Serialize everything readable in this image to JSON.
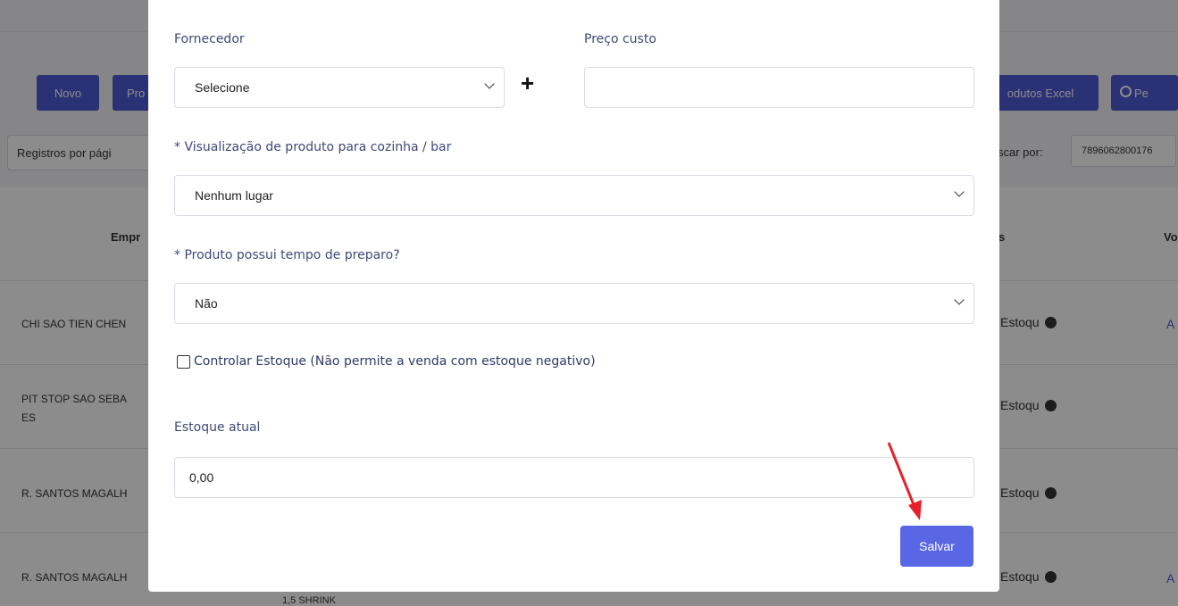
{
  "background": {
    "buttons": {
      "novo": "Novo",
      "pro": "Pro",
      "excel": "odutos Excel",
      "search": "Pe"
    },
    "records_label": "Registros por pági",
    "search_label": "scar por:",
    "search_value": "7896062800176",
    "table": {
      "header_company": "Empr",
      "header_s": "s",
      "header_v": "Vo",
      "rows": [
        {
          "company": "CHI SAO TIEN CHEN",
          "stock": "Estoqu",
          "link": "A"
        },
        {
          "company_line1": "PIT STOP SAO SEBA",
          "company_line2": "ES",
          "stock": "Estoqu"
        },
        {
          "company": "R. SANTOS MAGALH",
          "stock": "Estoqu"
        },
        {
          "company": "R. SANTOS MAGALH",
          "stock": "Estoqu",
          "link": "A",
          "extra": "1,5 SHRINK"
        }
      ]
    }
  },
  "modal": {
    "supplier_label": "Fornecedor",
    "supplier_value": "Selecione",
    "cost_label": "Preço custo",
    "cost_value": "",
    "kitchen_label": "* Visualização de produto para cozinha / bar",
    "kitchen_value": "Nenhum lugar",
    "prep_label": "* Produto possui tempo de preparo?",
    "prep_value": "Não",
    "control_stock_label": "Controlar Estoque (Não permite a venda com estoque negativo)",
    "control_stock_checked": false,
    "current_stock_label": "Estoque atual",
    "current_stock_value": "0,00",
    "save_label": "Salvar",
    "add_symbol": "+"
  },
  "colors": {
    "primary": "#5a67e4",
    "annotation_arrow": "#e8202a"
  }
}
